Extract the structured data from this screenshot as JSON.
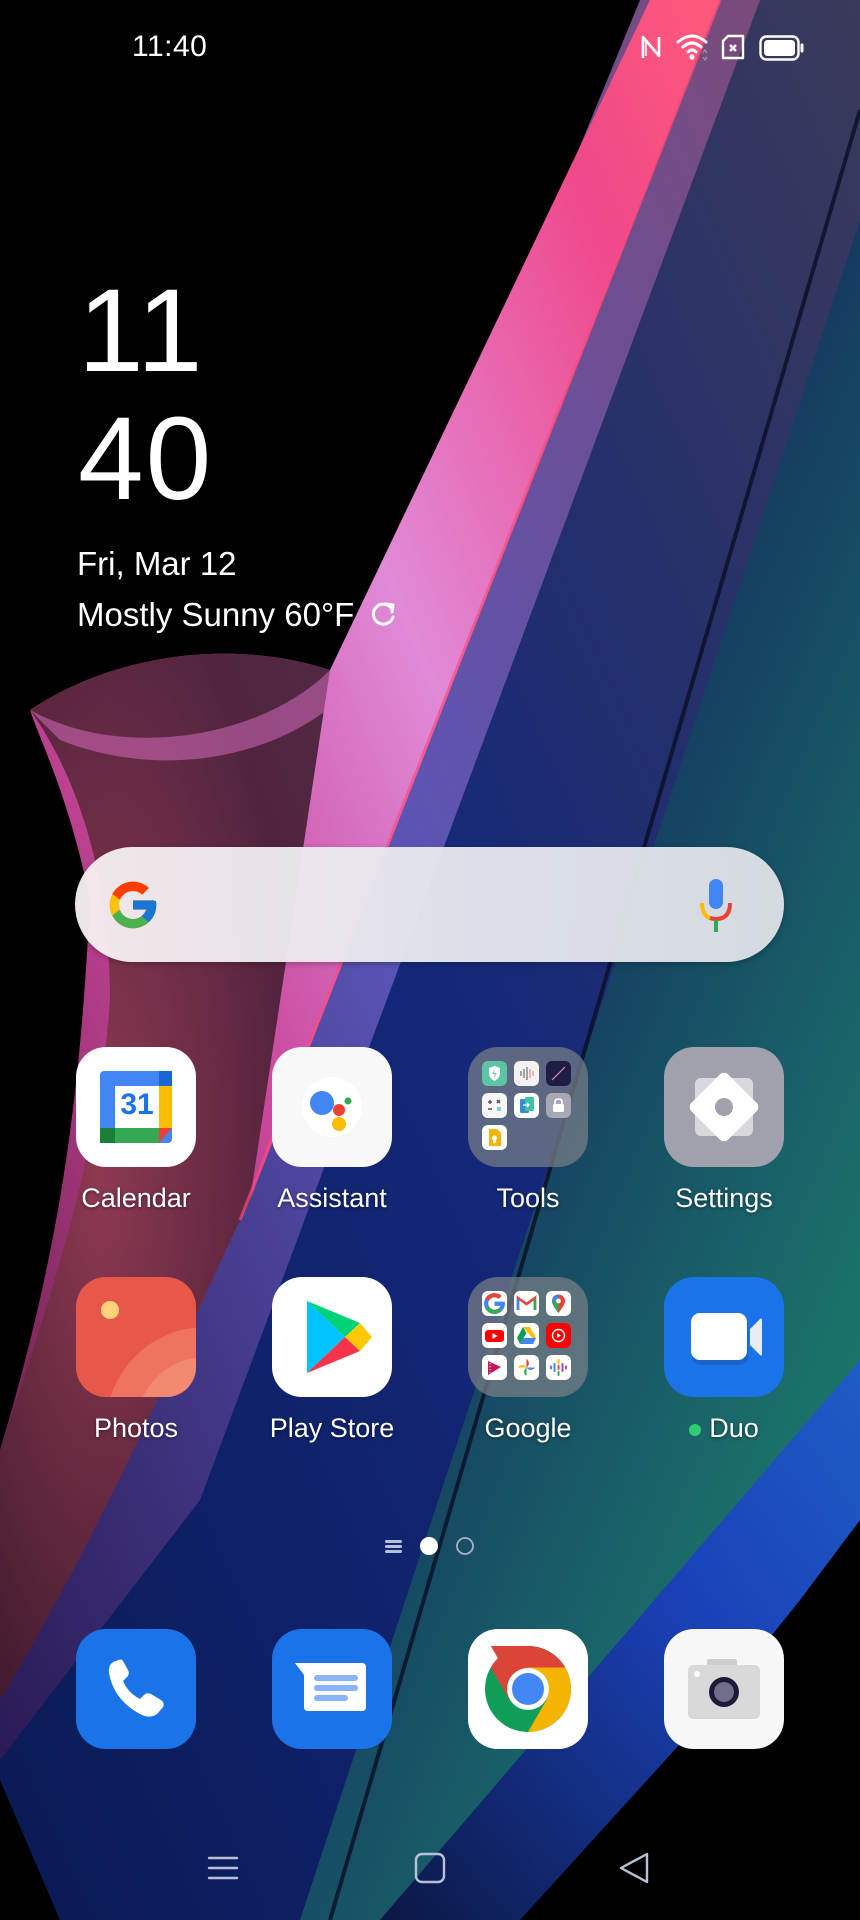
{
  "status_bar": {
    "time": "11:40",
    "icons": [
      "nfc-icon",
      "wifi-icon",
      "no-sim-icon",
      "battery-icon"
    ],
    "battery_level": 1.0
  },
  "clock_widget": {
    "hour": "11",
    "minute": "40",
    "date": "Fri, Mar 12",
    "weather": "Mostly Sunny 60°F",
    "refresh_icon": "refresh-icon"
  },
  "search_widget": {
    "logo_icon": "google-g-icon",
    "mic_icon": "microphone-icon"
  },
  "apps": [
    {
      "label": "Calendar",
      "icon": "calendar-icon",
      "calendar_day": "31"
    },
    {
      "label": "Assistant",
      "icon": "assistant-icon"
    },
    {
      "label": "Tools",
      "icon": "folder-icon",
      "folder_items": [
        "phone-manager",
        "sound-recorder",
        "compass",
        "calculator",
        "clone-phone",
        "app-lock",
        "notes"
      ]
    },
    {
      "label": "Settings",
      "icon": "settings-gear-icon"
    },
    {
      "label": "Photos",
      "icon": "photos-icon"
    },
    {
      "label": "Play Store",
      "icon": "play-store-icon"
    },
    {
      "label": "Google",
      "icon": "folder-icon",
      "folder_items": [
        "google",
        "gmail",
        "maps",
        "youtube",
        "drive",
        "youtube-music",
        "play-movies",
        "photos",
        "podcasts"
      ]
    },
    {
      "label": "Duo",
      "icon": "duo-video-icon",
      "new_badge": true,
      "badge_color": "#2ecc71"
    }
  ],
  "page_indicator": {
    "pages": 2,
    "current": 1,
    "drawer_icon": "app-drawer-icon"
  },
  "dock": [
    {
      "name": "Phone",
      "icon": "phone-icon"
    },
    {
      "name": "Messages",
      "icon": "messages-icon"
    },
    {
      "name": "Chrome",
      "icon": "chrome-icon"
    },
    {
      "name": "Camera",
      "icon": "camera-icon"
    }
  ],
  "nav_bar": {
    "recents": "recents-icon",
    "home": "home-icon",
    "back": "back-icon"
  },
  "colors": {
    "google_blue": "#4285F4",
    "google_red": "#EA4335",
    "google_yellow": "#FBBC05",
    "google_green": "#34A853",
    "dock_blue": "#1A73E8",
    "photos_red": "#E8584A"
  }
}
